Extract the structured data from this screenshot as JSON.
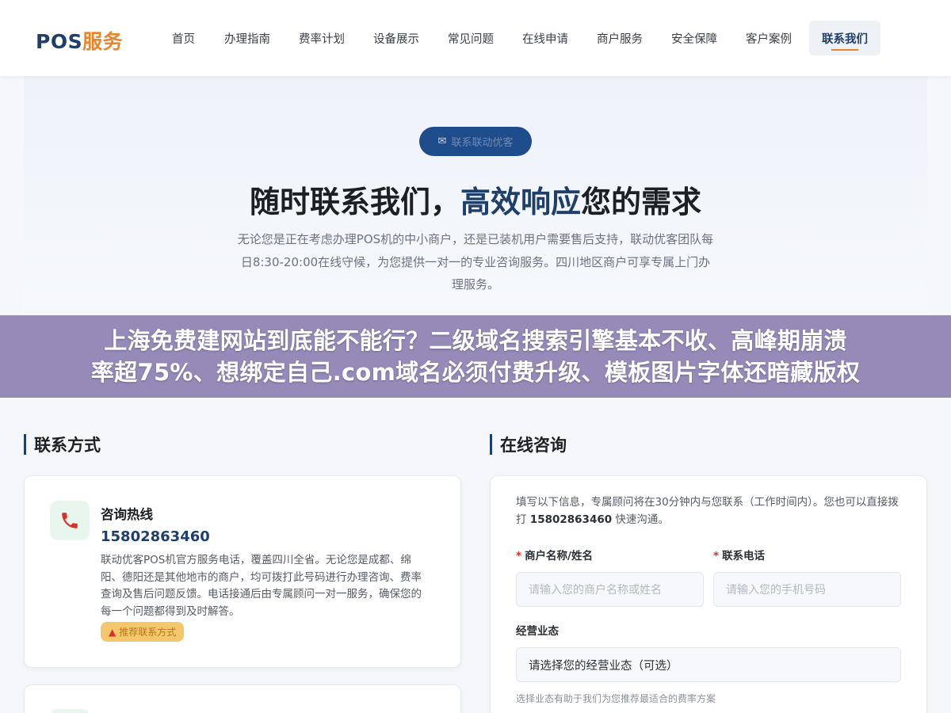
{
  "header": {
    "logo_pos": "POS",
    "logo_service": "服务",
    "nav": [
      {
        "label": "首页"
      },
      {
        "label": "办理指南"
      },
      {
        "label": "费率计划"
      },
      {
        "label": "设备展示"
      },
      {
        "label": "常见问题"
      },
      {
        "label": "在线申请"
      },
      {
        "label": "商户服务"
      },
      {
        "label": "安全保障"
      },
      {
        "label": "客户案例"
      },
      {
        "label": "联系我们",
        "active": true
      }
    ]
  },
  "hero": {
    "badge_icon": "mailbox-icon",
    "badge_label": "联系联动优客",
    "title_part1": "随时联系我们，",
    "title_highlight": "高效响应",
    "title_part2": "您的需求",
    "description": "无论您是正在考虑办理POS机的中小商户，还是已装机用户需要售后支持，联动优客团队每日8:30-20:00在线守候，为您提供一对一的专业咨询服务。四川地区商户可享专属上门办理服务。"
  },
  "overlay": {
    "line1": "上海免费建网站到底能不能行？二级域名搜索引擎基本不收、高峰期崩溃",
    "line2": "率超75%、想绑定自己.com域名必须付费升级、模板图片字体还暗藏版权"
  },
  "contact": {
    "section_title": "联系方式",
    "hotline": {
      "icon": "phone-icon",
      "title": "咨询热线",
      "number": "15802863460",
      "description": "联动优客POS机官方服务电话，覆盖四川全省。无论您是成都、绵阳、德阳还是其他地市的商户，均可拨打此号码进行办理咨询、费率查询及售后问题反馈。电话接通后由专属顾问一对一服务，确保您的每一个问题都得到及时解答。",
      "tag_icon": "fire-icon",
      "tag": "推荐联系方式"
    }
  },
  "consult": {
    "section_title": "在线咨询",
    "intro_part1": "填写以下信息，专属顾问将在30分钟内与您联系（工作时间内）。您也可以直接拨打 ",
    "intro_number": "15802863460",
    "intro_part2": " 快速沟通。",
    "name_label": "商户名称/姓名",
    "name_placeholder": "请输入您的商户名称或姓名",
    "phone_label": "联系电话",
    "phone_placeholder": "请输入您的手机号码",
    "biz_label": "经营业态",
    "biz_selected": "请选择您的经营业态（可选）",
    "biz_hint": "选择业态有助于我们为您推荐最适合的费率方案",
    "required_mark": "*"
  },
  "colors": {
    "brand_navy": "#1f3f6b",
    "brand_orange": "#e8862e",
    "overlay_purple": "#8c80b2",
    "required_red": "#d9302c"
  }
}
